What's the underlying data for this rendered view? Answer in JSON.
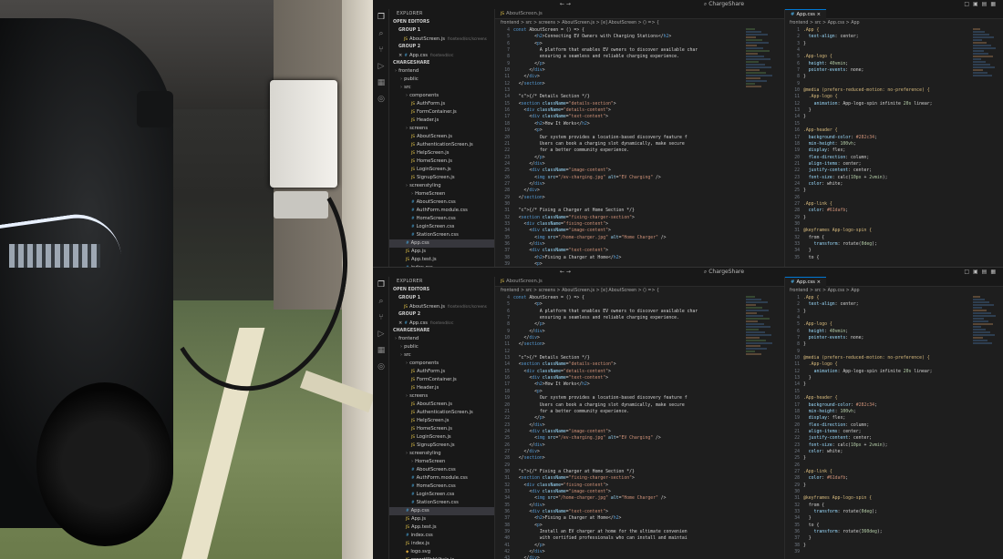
{
  "app": {
    "title": "ChargeShare"
  },
  "activity": [
    "files-icon",
    "search-icon",
    "source-control-icon",
    "run-debug-icon",
    "extensions-icon",
    "remote-icon"
  ],
  "explorer": {
    "header": "EXPLORER",
    "open_editors": "OPEN EDITORS",
    "group1": "GROUP 1",
    "group1_file": "AboutScreen.js",
    "group1_path": "frontend/src/screens",
    "group2": "GROUP 2",
    "group2_file": "App.css",
    "group2_path": "frontend/src",
    "project": "CHARGESHARE",
    "tree": [
      {
        "label": "frontend",
        "depth": 1,
        "kind": "folder"
      },
      {
        "label": "public",
        "depth": 2,
        "kind": "folder"
      },
      {
        "label": "src",
        "depth": 2,
        "kind": "folder"
      },
      {
        "label": "components",
        "depth": 3,
        "kind": "folder"
      },
      {
        "label": "AuthForm.js",
        "depth": 4,
        "kind": "js"
      },
      {
        "label": "FormContainer.js",
        "depth": 4,
        "kind": "js"
      },
      {
        "label": "Header.js",
        "depth": 4,
        "kind": "js"
      },
      {
        "label": "screens",
        "depth": 3,
        "kind": "folder"
      },
      {
        "label": "AboutScreen.js",
        "depth": 4,
        "kind": "js"
      },
      {
        "label": "AuthenticationScreen.js",
        "depth": 4,
        "kind": "js"
      },
      {
        "label": "HelpScreen.js",
        "depth": 4,
        "kind": "js"
      },
      {
        "label": "HomeScreen.js",
        "depth": 4,
        "kind": "js"
      },
      {
        "label": "LoginScreen.js",
        "depth": 4,
        "kind": "js"
      },
      {
        "label": "SignupScreen.js",
        "depth": 4,
        "kind": "js"
      },
      {
        "label": "screenstyling",
        "depth": 3,
        "kind": "folder"
      },
      {
        "label": "HomeScreen",
        "depth": 4,
        "kind": "folder"
      },
      {
        "label": "AboutScreen.css",
        "depth": 4,
        "kind": "css"
      },
      {
        "label": "AuthForm.module.css",
        "depth": 4,
        "kind": "css"
      },
      {
        "label": "HomeScreen.css",
        "depth": 4,
        "kind": "css"
      },
      {
        "label": "LoginScreen.css",
        "depth": 4,
        "kind": "css"
      },
      {
        "label": "StationScreen.css",
        "depth": 4,
        "kind": "css"
      },
      {
        "label": "App.css",
        "depth": 3,
        "kind": "css",
        "selected": true
      },
      {
        "label": "App.js",
        "depth": 3,
        "kind": "js"
      },
      {
        "label": "App.test.js",
        "depth": 3,
        "kind": "js"
      },
      {
        "label": "index.css",
        "depth": 3,
        "kind": "css"
      },
      {
        "label": "index.js",
        "depth": 3,
        "kind": "js"
      },
      {
        "label": "logo.svg",
        "depth": 3,
        "kind": "svg"
      },
      {
        "label": "reportWebVitals.js",
        "depth": 3,
        "kind": "js"
      }
    ]
  },
  "tabs": {
    "left": "AboutScreen.js",
    "right": "App.css"
  },
  "breadcrumb_left": "frontend > src > screens > AboutScreen.js > [e] AboutScreen > () => {",
  "breadcrumb_right": "frontend > src > App.css > App",
  "js_top": {
    "start": 4,
    "lines": [
      "const AboutScreen = () => {",
      "        <h2>Connecting EV Owners with Charging Stations</h2>",
      "        <p>",
      "          A platform that enables EV owners to discover available char",
      "          ensuring a seamless and reliable charging experience.",
      "        </p>",
      "      </div>",
      "    </div>",
      "  </section>",
      "",
      "  {/* Details Section */}",
      "  <section className=\"details-section\">",
      "    <div className=\"details-content\">",
      "      <div className=\"text-content\">",
      "        <h2>How It Works</h2>",
      "        <p>",
      "          Our system provides a location-based discovery feature f",
      "          Users can book a charging slot dynamically, make secure",
      "          for a better community experience.",
      "        </p>",
      "      </div>",
      "      <div className=\"image-content\">",
      "        <img src=\"/ev-charging.jpg\" alt=\"EV Charging\" />",
      "      </div>",
      "    </div>",
      "  </section>",
      "",
      "  {/* Fixing a Charger at Home Section */}",
      "  <section className=\"fixing-charger-section\">",
      "    <div className=\"fixing-content\">",
      "      <div className=\"image-content\">",
      "        <img src=\"/home-charger.jpg\" alt=\"Home Charger\" />",
      "      </div>",
      "      <div className=\"text-content\">",
      "        <h2>Fixing a Charger at Home</h2>",
      "        <p>"
    ]
  },
  "js_bot": {
    "start": 4,
    "lines": [
      "const AboutScreen = () => {",
      "        <p>",
      "          A platform that enables EV owners to discover available char",
      "          ensuring a seamless and reliable charging experience.",
      "        </p>",
      "      </div>",
      "    </div>",
      "  </section>",
      "",
      "  {/* Details Section */}",
      "  <section className=\"details-section\">",
      "    <div className=\"details-content\">",
      "      <div className=\"text-content\">",
      "        <h2>How It Works</h2>",
      "        <p>",
      "          Our system provides a location-based discovery feature f",
      "          Users can book a charging slot dynamically, make secure",
      "          for a better community experience.",
      "        </p>",
      "      </div>",
      "      <div className=\"image-content\">",
      "        <img src=\"/ev-charging.jpg\" alt=\"EV Charging\" />",
      "      </div>",
      "    </div>",
      "  </section>",
      "",
      "  {/* Fixing a Charger at Home Section */}",
      "  <section className=\"fixing-charger-section\">",
      "    <div className=\"fixing-content\">",
      "      <div className=\"image-content\">",
      "        <img src=\"/home-charger.jpg\" alt=\"Home Charger\" />",
      "      </div>",
      "      <div className=\"text-content\">",
      "        <h2>Fixing a Charger at Home</h2>",
      "        <p>",
      "          Install an EV charger at home for the ultimate convenien",
      "          with certified professionals who can install and maintai",
      "        </p>",
      "      </div>",
      "    </div>"
    ]
  },
  "css_top": {
    "start": 1,
    "lines": [
      ".App {",
      "  text-align: center;",
      "}",
      "",
      ".App-logo {",
      "  height: 40vmin;",
      "  pointer-events: none;",
      "}",
      "",
      "@media (prefers-reduced-motion: no-preference) {",
      "  .App-logo {",
      "    animation: App-logo-spin infinite 20s linear;",
      "  }",
      "}",
      "",
      ".App-header {",
      "  background-color: #282c34;",
      "  min-height: 100vh;",
      "  display: flex;",
      "  flex-direction: column;",
      "  align-items: center;",
      "  justify-content: center;",
      "  font-size: calc(10px + 2vmin);",
      "  color: white;",
      "}",
      "",
      ".App-link {",
      "  color: #61dafb;",
      "}",
      "",
      "@keyframes App-logo-spin {",
      "  from {",
      "    transform: rotate(0deg);",
      "  }",
      "  to {"
    ]
  },
  "css_bot": {
    "start": 1,
    "lines": [
      ".App {",
      "  text-align: center;",
      "}",
      "",
      ".App-logo {",
      "  height: 40vmin;",
      "  pointer-events: none;",
      "}",
      "",
      "@media (prefers-reduced-motion: no-preference) {",
      "  .App-logo {",
      "    animation: App-logo-spin infinite 20s linear;",
      "  }",
      "}",
      "",
      ".App-header {",
      "  background-color: #282c34;",
      "  min-height: 100vh;",
      "  display: flex;",
      "  flex-direction: column;",
      "  align-items: center;",
      "  justify-content: center;",
      "  font-size: calc(10px + 2vmin);",
      "  color: white;",
      "}",
      "",
      ".App-link {",
      "  color: #61dafb;",
      "}",
      "",
      "@keyframes App-logo-spin {",
      "  from {",
      "    transform: rotate(0deg);",
      "  }",
      "  to {",
      "    transform: rotate(360deg);",
      "  }",
      "}",
      ""
    ]
  }
}
